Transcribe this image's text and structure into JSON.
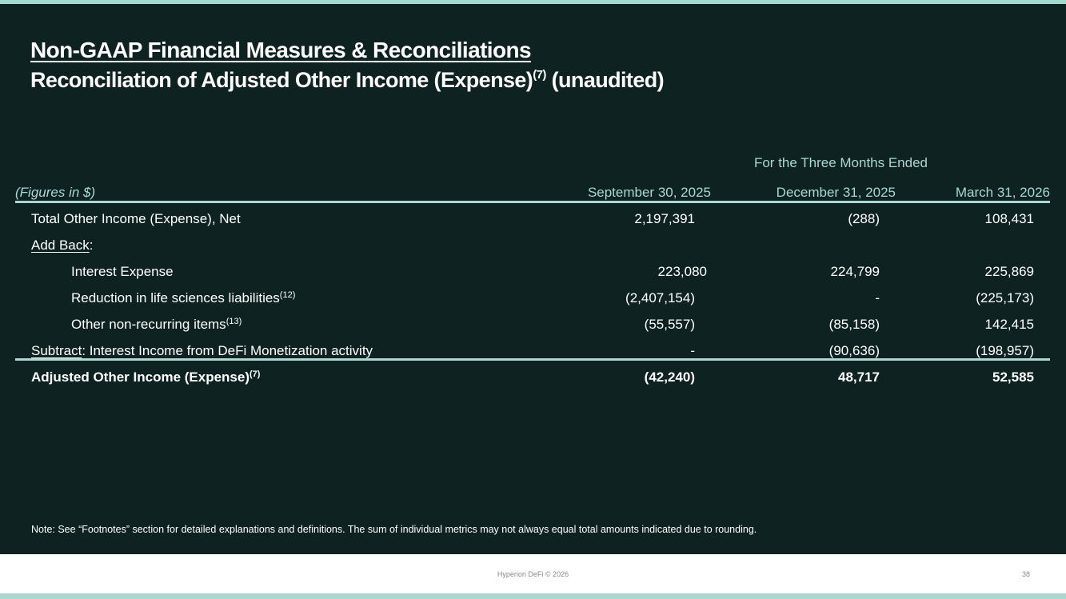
{
  "title": "Non-GAAP Financial Measures & Reconciliations",
  "subtitle": {
    "main": "Reconciliation of Adjusted Other Income (Expense)",
    "footnote": "(7)",
    "suffix": " (unaudited)"
  },
  "table": {
    "period_header": "For the Three Months Ended",
    "units_label": "(Figures in $)",
    "columns": [
      "September 30, 2025",
      "December 31, 2025",
      "March 31, 2026"
    ],
    "rows": [
      {
        "label": "Total Other Income (Expense), Net",
        "footnote": "",
        "values": [
          "2,197,391",
          "(288)",
          "108,431"
        ]
      },
      {
        "label_underlined": "Add Back",
        "label_rest": ":"
      },
      {
        "label": "Interest Expense",
        "footnote": "",
        "values": [
          "223,080",
          "224,799",
          "225,869"
        ]
      },
      {
        "label": "Reduction in life sciences liabilities",
        "footnote": "(12)",
        "values": [
          "(2,407,154)",
          "-",
          "(225,173)"
        ]
      },
      {
        "label": "Other non-recurring items",
        "footnote": "(13)",
        "values": [
          "(55,557)",
          "(85,158)",
          "142,415"
        ]
      },
      {
        "label_underlined": "Subtract",
        "label_rest": ": Interest Income from DeFi Monetization activity",
        "values": [
          "-",
          "(90,636)",
          "(198,957)"
        ]
      },
      {
        "label": "Adjusted Other Income (Expense)",
        "footnote": "(7)",
        "values": [
          "(42,240)",
          "48,717",
          "52,585"
        ]
      }
    ]
  },
  "note": "Note: See “Footnotes” section for detailed explanations and definitions. The sum of individual metrics may not always equal total amounts indicated due to rounding.",
  "footer": {
    "company": "Hyperion DeFi © 2026",
    "page": "38"
  },
  "colors": {
    "background": "#0e2321",
    "accent": "#a8d8cf",
    "text": "#ffffff"
  }
}
